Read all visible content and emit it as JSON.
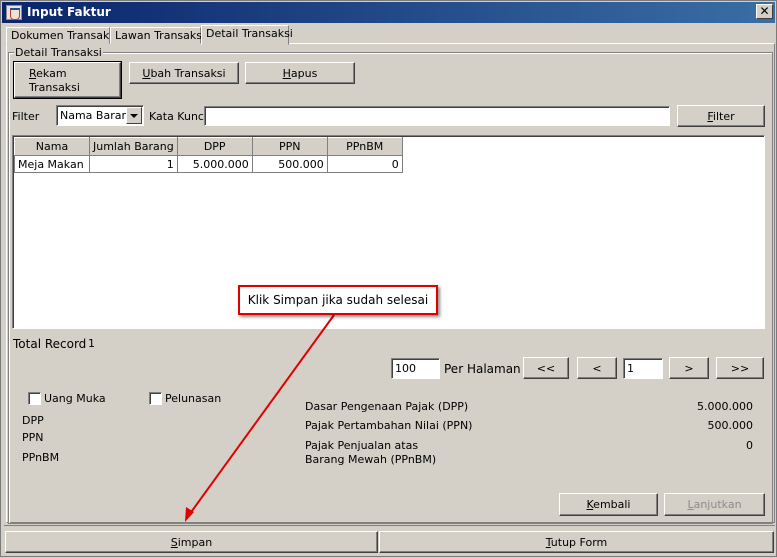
{
  "window": {
    "title": "Input Faktur",
    "close_label": "✕"
  },
  "tabs": [
    {
      "label": "Dokumen Transaksi",
      "active": false
    },
    {
      "label": "Lawan Transaksi",
      "active": false
    },
    {
      "label": "Detail Transaksi",
      "active": true
    }
  ],
  "group": {
    "legend": "Detail Transaksi"
  },
  "toolbar": {
    "rekam_label": "Rekam Transaksi",
    "ubah_label": "Ubah Transaksi",
    "hapus_label": "Hapus"
  },
  "filter": {
    "label": "Filter",
    "field_selected": "Nama Barang",
    "keyword_label": "Kata Kunci",
    "keyword_value": "",
    "button_label": "Filter"
  },
  "table": {
    "columns": [
      "Nama",
      "Jumlah Barang",
      "DPP",
      "PPN",
      "PPnBM"
    ],
    "rows": [
      {
        "nama": "Meja Makan",
        "jumlah": "1",
        "dpp": "5.000.000",
        "ppn": "500.000",
        "ppnbm": "0"
      }
    ]
  },
  "total_record": {
    "label": "Total Record",
    "value": "1"
  },
  "paging": {
    "per_page_value": "100",
    "per_page_label": "Per Halaman",
    "first_label": "<<",
    "prev_label": "<",
    "page_value": "1",
    "next_label": ">",
    "last_label": ">>"
  },
  "options": {
    "uang_muka_label": "Uang Muka",
    "pelunasan_label": "Pelunasan"
  },
  "left_summary": {
    "dpp_label": "DPP",
    "ppn_label": "PPN",
    "ppnbm_label": "PPnBM"
  },
  "summary": {
    "dpp_label": "Dasar Pengenaan Pajak (DPP)",
    "dpp_value": "5.000.000",
    "ppn_label": "Pajak Pertambahan Nilai (PPN)",
    "ppn_value": "500.000",
    "ppnbm_label_line1": "Pajak Penjualan atas",
    "ppnbm_label_line2": "Barang Mewah (PPnBM)",
    "ppnbm_value": "0"
  },
  "nav": {
    "kembali_label": "Kembali",
    "lanjutkan_label": "Lanjutkan"
  },
  "footer": {
    "simpan_label": "Simpan",
    "tutup_label": "Tutup Form"
  },
  "callout": {
    "text": "Klik Simpan jika sudah selesai",
    "color": "#e00000"
  }
}
